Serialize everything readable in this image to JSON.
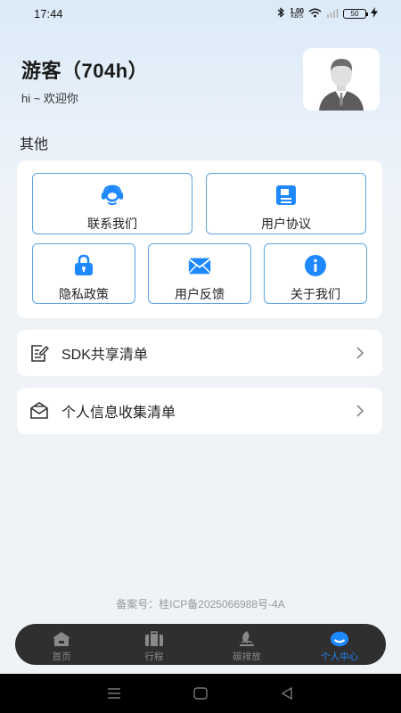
{
  "status_bar": {
    "time": "17:44",
    "network_speed_value": "1.00",
    "network_speed_unit": "KB/S",
    "battery": "50"
  },
  "header": {
    "user_name": "游客（704h）",
    "greeting": "hi ~ 欢迎你"
  },
  "section_title": "其他",
  "tiles": [
    {
      "label": "联系我们",
      "icon": "customer-service-icon"
    },
    {
      "label": "用户协议",
      "icon": "document-icon"
    },
    {
      "label": "隐私政策",
      "icon": "lock-icon"
    },
    {
      "label": "用户反馈",
      "icon": "mail-icon"
    },
    {
      "label": "关于我们",
      "icon": "info-icon"
    }
  ],
  "list_rows": [
    {
      "label": "SDK共享清单",
      "icon": "clipboard-edit-icon"
    },
    {
      "label": "个人信息收集清单",
      "icon": "envelope-open-icon"
    }
  ],
  "beian": "备案号：桂ICP备2025066988号-4A",
  "tabs": [
    {
      "label": "首页",
      "icon": "home-icon",
      "active": false
    },
    {
      "label": "行程",
      "icon": "luggage-icon",
      "active": false
    },
    {
      "label": "碳排放",
      "icon": "leaf-icon",
      "active": false
    },
    {
      "label": "个人中心",
      "icon": "profile-icon",
      "active": true
    }
  ],
  "colors": {
    "accent": "#1e88ff",
    "tile_border": "#5aa4e6",
    "tabbar_bg": "#2f2f2f"
  }
}
